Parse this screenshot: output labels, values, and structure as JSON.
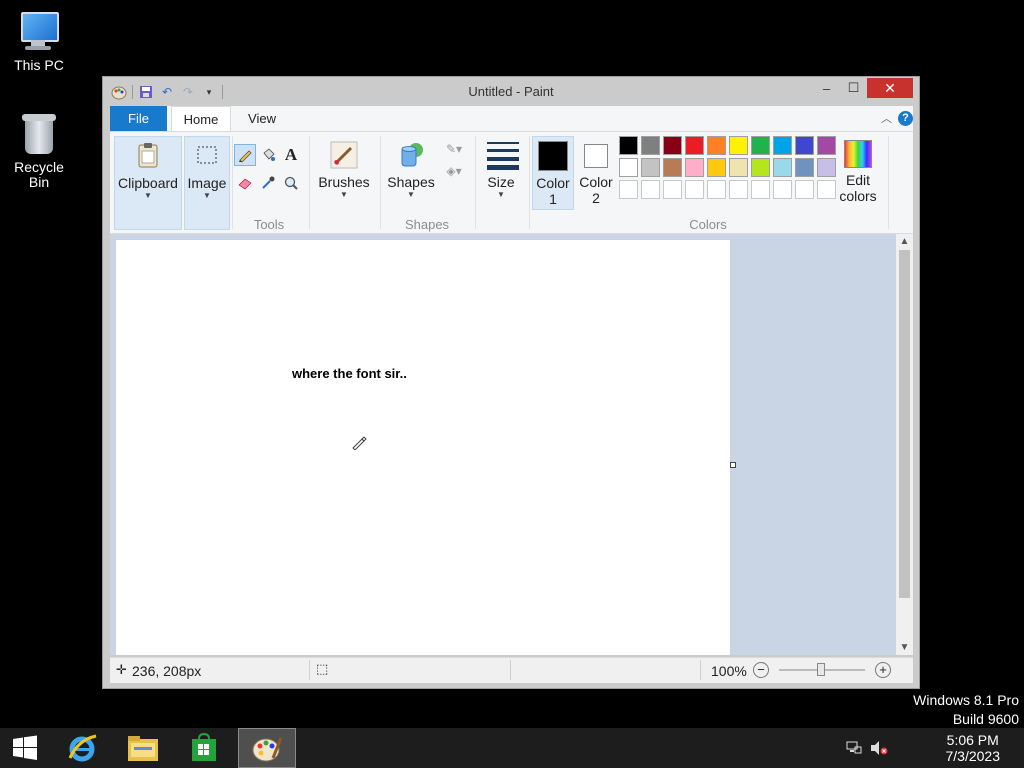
{
  "desktop": {
    "icons": [
      {
        "label": "This PC"
      },
      {
        "label": "Recycle Bin"
      }
    ],
    "os_label": {
      "line1": "Windows 8.1 Pro",
      "line2": "Build 9600"
    }
  },
  "window": {
    "title": "Untitled - Paint",
    "controls": {
      "minimize": "–",
      "maximize": "☐",
      "close": "✕"
    }
  },
  "tabs": {
    "file": "File",
    "home": "Home",
    "view": "View"
  },
  "ribbon": {
    "clipboard": "Clipboard",
    "image": "Image",
    "tools_group": "Tools",
    "brushes": "Brushes",
    "shapes": "Shapes",
    "shapes_group": "Shapes",
    "size": "Size",
    "color1_line1": "Color",
    "color1_line2": "1",
    "color2_line1": "Color",
    "color2_line2": "2",
    "colors_group": "Colors",
    "edit_colors_line1": "Edit",
    "edit_colors_line2": "colors",
    "primary_color": "#000000",
    "secondary_color": "#ffffff",
    "palette_row1": [
      "#000000",
      "#7f7f7f",
      "#880015",
      "#ed1c24",
      "#ff7f27",
      "#fff200",
      "#22b14c",
      "#00a2e8",
      "#3f48cc",
      "#a349a4"
    ],
    "palette_row2": [
      "#ffffff",
      "#c3c3c3",
      "#b97a57",
      "#ffaec9",
      "#ffc90e",
      "#efe4b0",
      "#b5e61d",
      "#99d9ea",
      "#7092be",
      "#c8bfe7"
    ]
  },
  "canvas": {
    "text": "where the font sir.."
  },
  "status": {
    "position": "236, 208px",
    "zoom": "100%"
  },
  "taskbar": {
    "time": "5:06 PM",
    "date": "7/3/2023"
  }
}
